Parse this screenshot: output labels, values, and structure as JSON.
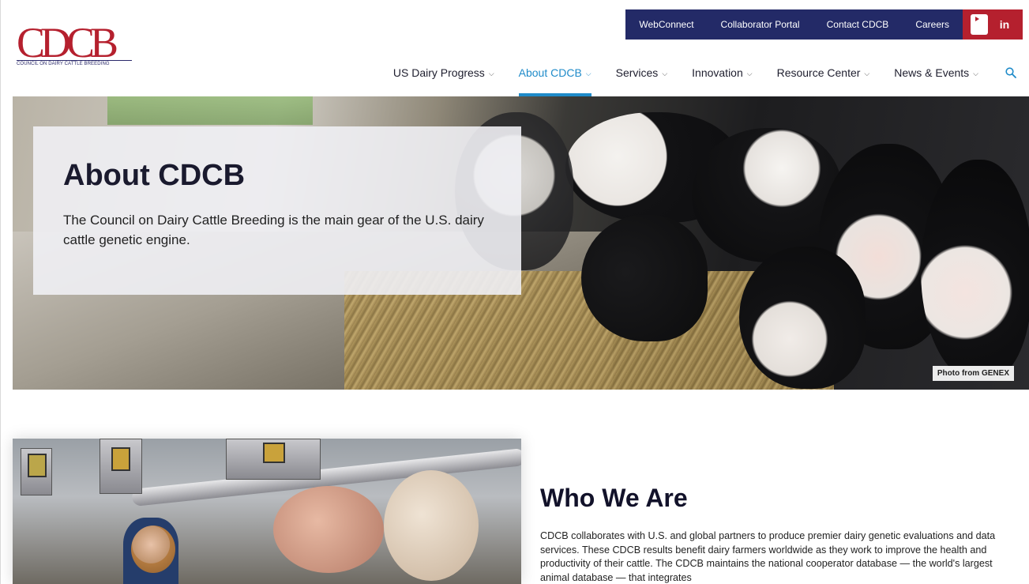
{
  "logo": {
    "wordmark": "CDCB",
    "tagline": "COUNCIL ON DAIRY CATTLE BREEDING"
  },
  "utility_nav": {
    "items": [
      "WebConnect",
      "Collaborator Portal",
      "Contact CDCB",
      "Careers"
    ],
    "social": [
      "youtube-icon",
      "linkedin-icon"
    ],
    "linkedin_label": "in",
    "bar_color": "#232a67",
    "social_color": "#b5202e"
  },
  "main_nav": {
    "items": [
      {
        "label": "US Dairy Progress",
        "active": false
      },
      {
        "label": "About CDCB",
        "active": true
      },
      {
        "label": "Services",
        "active": false
      },
      {
        "label": "Innovation",
        "active": false
      },
      {
        "label": "Resource Center",
        "active": false
      },
      {
        "label": "News & Events",
        "active": false
      }
    ],
    "active_color": "#1f8bc9"
  },
  "hero": {
    "title": "About CDCB",
    "description": "The Council on Dairy Cattle Breeding is the main gear of the U.S. dairy cattle genetic engine.",
    "photo_credit": "Photo from GENEX"
  },
  "who_we_are": {
    "title": "Who We Are",
    "body": "CDCB collaborates with U.S. and global partners to produce premier dairy genetic evaluations and data services. These CDCB results benefit dairy farmers worldwide as they work to improve the health and productivity of their cattle. The CDCB maintains the national cooperator database — the world's largest animal database — that integrates"
  }
}
